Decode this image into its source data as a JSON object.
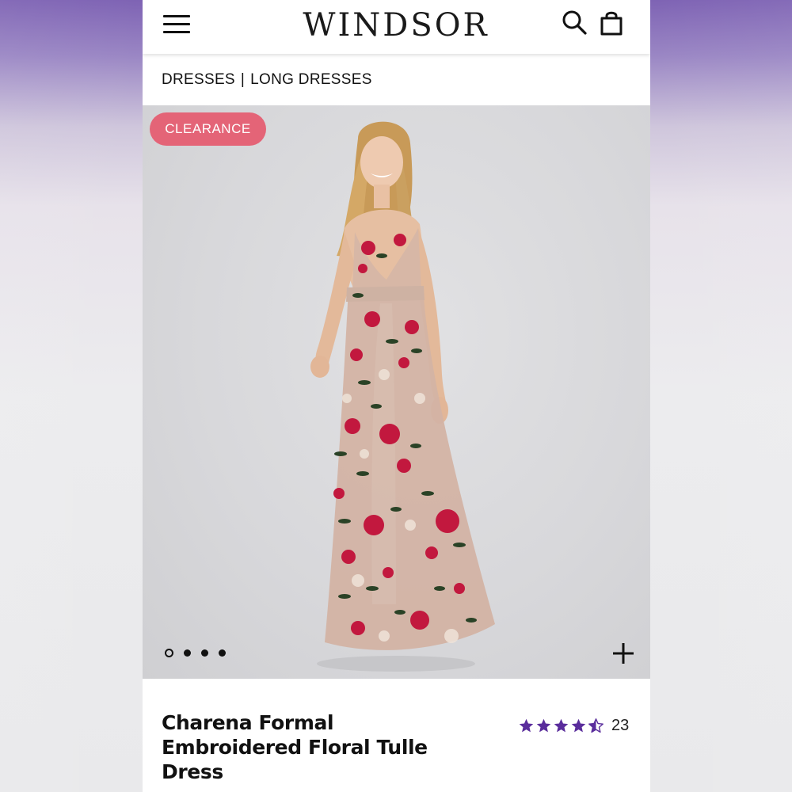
{
  "header": {
    "brand": "WINDSOR",
    "menu_icon": "hamburger-menu-icon",
    "search_icon": "search-icon",
    "bag_icon": "shopping-bag-icon"
  },
  "breadcrumb": {
    "items": [
      "DRESSES",
      "LONG DRESSES"
    ],
    "separator": "|"
  },
  "gallery": {
    "badge": "CLEARANCE",
    "badge_color": "#e46477",
    "image_count": 4,
    "active_index": 0,
    "zoom_icon": "plus-icon"
  },
  "product": {
    "title": "Charena Formal Embroidered Floral Tulle Dress",
    "rating": 4.5,
    "rating_max": 5,
    "review_count": "23",
    "star_color": "#5a2d9c"
  }
}
